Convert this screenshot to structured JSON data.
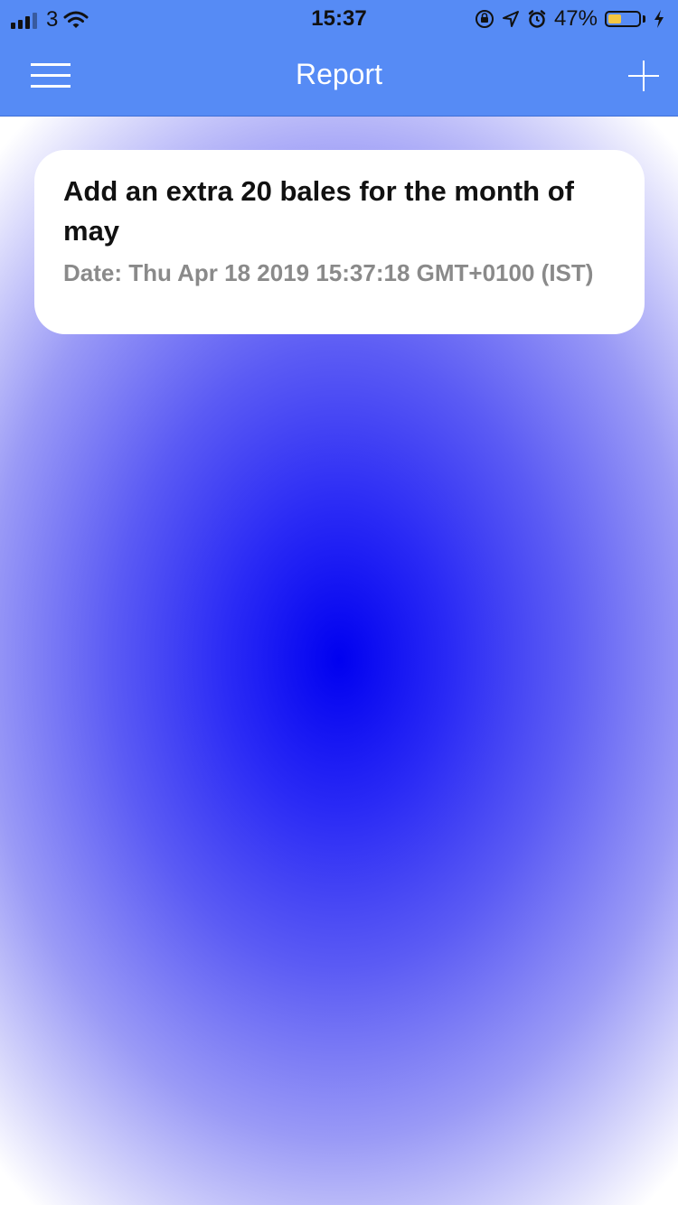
{
  "status_bar": {
    "carrier": "3",
    "time": "15:37",
    "battery_percent": "47%",
    "battery_level": 0.47,
    "icons": [
      "signal-icon",
      "wifi-icon",
      "orientation-lock-icon",
      "location-arrow-icon",
      "alarm-icon",
      "battery-icon",
      "charging-bolt-icon"
    ]
  },
  "navbar": {
    "title": "Report",
    "left_icon": "hamburger-menu-icon",
    "right_icon": "plus-icon"
  },
  "reports": [
    {
      "title": "Add an extra 20 bales for the month of may",
      "date": "Date: Thu Apr 18 2019 15:37:18 GMT+0100 (IST)"
    }
  ],
  "colors": {
    "navbar": "#568bf5",
    "card": "#ffffff",
    "background_center": "#0000f0",
    "date_text": "#8a8a8a"
  }
}
